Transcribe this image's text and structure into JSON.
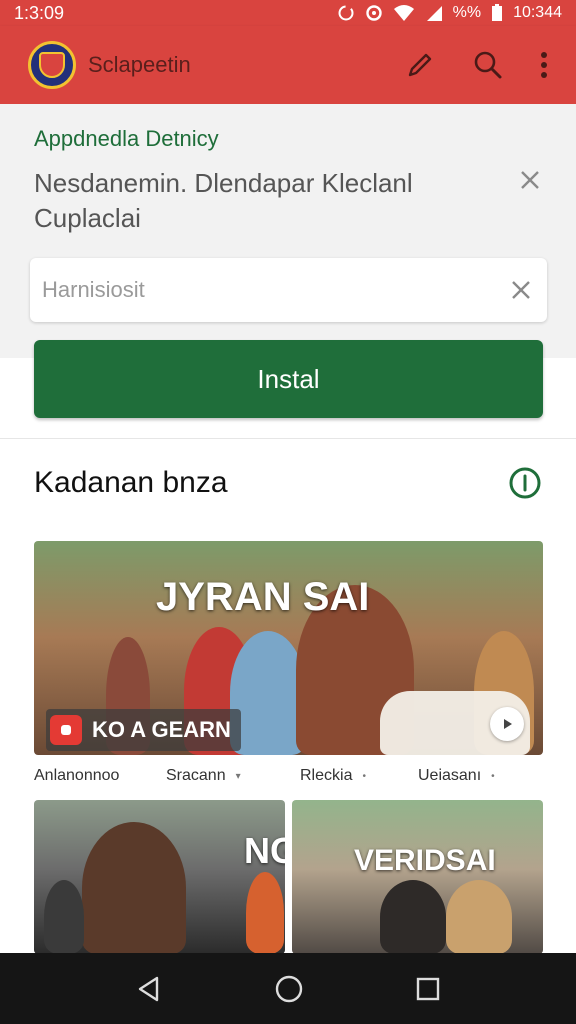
{
  "status_bar": {
    "time_left": "1:3:09",
    "battery": "%%",
    "time_right": "10:344",
    "icons": [
      "sync-icon",
      "notification-icon",
      "wifi-icon",
      "signal-icon",
      "battery-icon"
    ]
  },
  "app_bar": {
    "title": "Sclapeetin",
    "actions": [
      "edit-icon",
      "search-icon",
      "more-icon"
    ],
    "color": "#d9443f"
  },
  "install_banner": {
    "title": "Appdnedla Detnicy",
    "message": "Nesdanemin. Dlendapar Kleclanl Cuplaclai",
    "input_placeholder": "Harnisiosit",
    "button_label": "Instal",
    "button_color": "#1f6e3a"
  },
  "section": {
    "title": "Kadanan bnza"
  },
  "featured": {
    "overlay_title": "JYRAN SAI",
    "label": "KO A GEARN"
  },
  "filters": [
    "Anlanonnoo",
    "Sracann",
    "Rleckia",
    "Ueiasanı"
  ],
  "thumbnails": [
    {
      "overlay_title": "NG"
    },
    {
      "overlay_title": "VERIDSAI"
    }
  ],
  "nav_bar": {
    "buttons": [
      "back-icon",
      "home-icon",
      "recents-icon"
    ]
  }
}
